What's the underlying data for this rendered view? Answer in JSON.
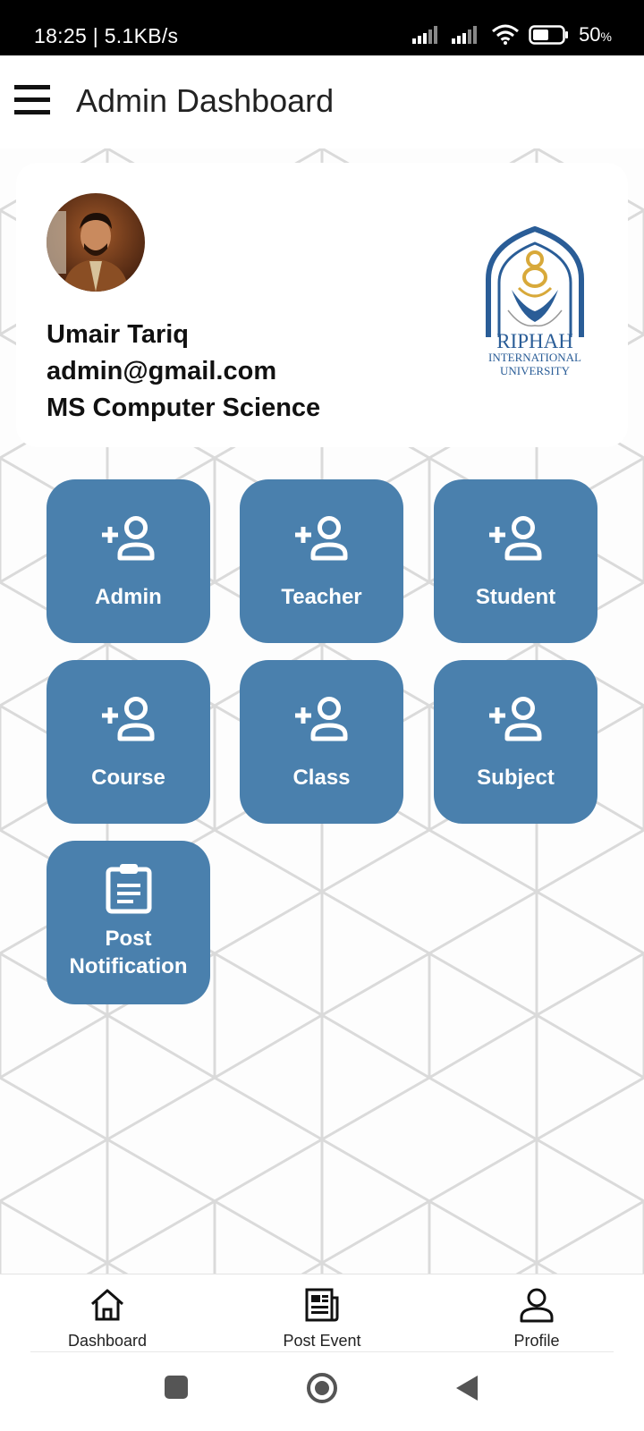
{
  "status_bar": {
    "time": "18:25 | 5.1KB/s",
    "battery_value": "50",
    "battery_unit": "%"
  },
  "app_bar": {
    "menu_icon": "hamburger-menu-icon",
    "title": "Admin Dashboard"
  },
  "profile": {
    "name": "Umair Tariq",
    "email": "admin@gmail.com",
    "program": "MS Computer Science",
    "logo_text": [
      "RIPHAH",
      "INTERNATIONAL",
      "UNIVERSITY"
    ]
  },
  "tiles": [
    {
      "label": "Admin",
      "icon": "add-person-icon"
    },
    {
      "label": "Teacher",
      "icon": "add-person-icon"
    },
    {
      "label": "Student",
      "icon": "add-person-icon"
    },
    {
      "label": "Course",
      "icon": "add-person-icon"
    },
    {
      "label": "Class",
      "icon": "add-person-icon"
    },
    {
      "label": "Subject",
      "icon": "add-person-icon"
    },
    {
      "label_line1": "Post",
      "label_line2": "Notification",
      "icon": "clipboard-icon"
    }
  ],
  "bottom_nav": [
    {
      "label": "Dashboard",
      "icon": "home-icon"
    },
    {
      "label": "Post Event",
      "icon": "newspaper-icon"
    },
    {
      "label": "Profile",
      "icon": "person-icon"
    }
  ],
  "colors": {
    "tile": "#4a80ad",
    "status_bar": "#000000",
    "logo_blue": "#2a5d97",
    "logo_gold": "#d8a93a"
  }
}
